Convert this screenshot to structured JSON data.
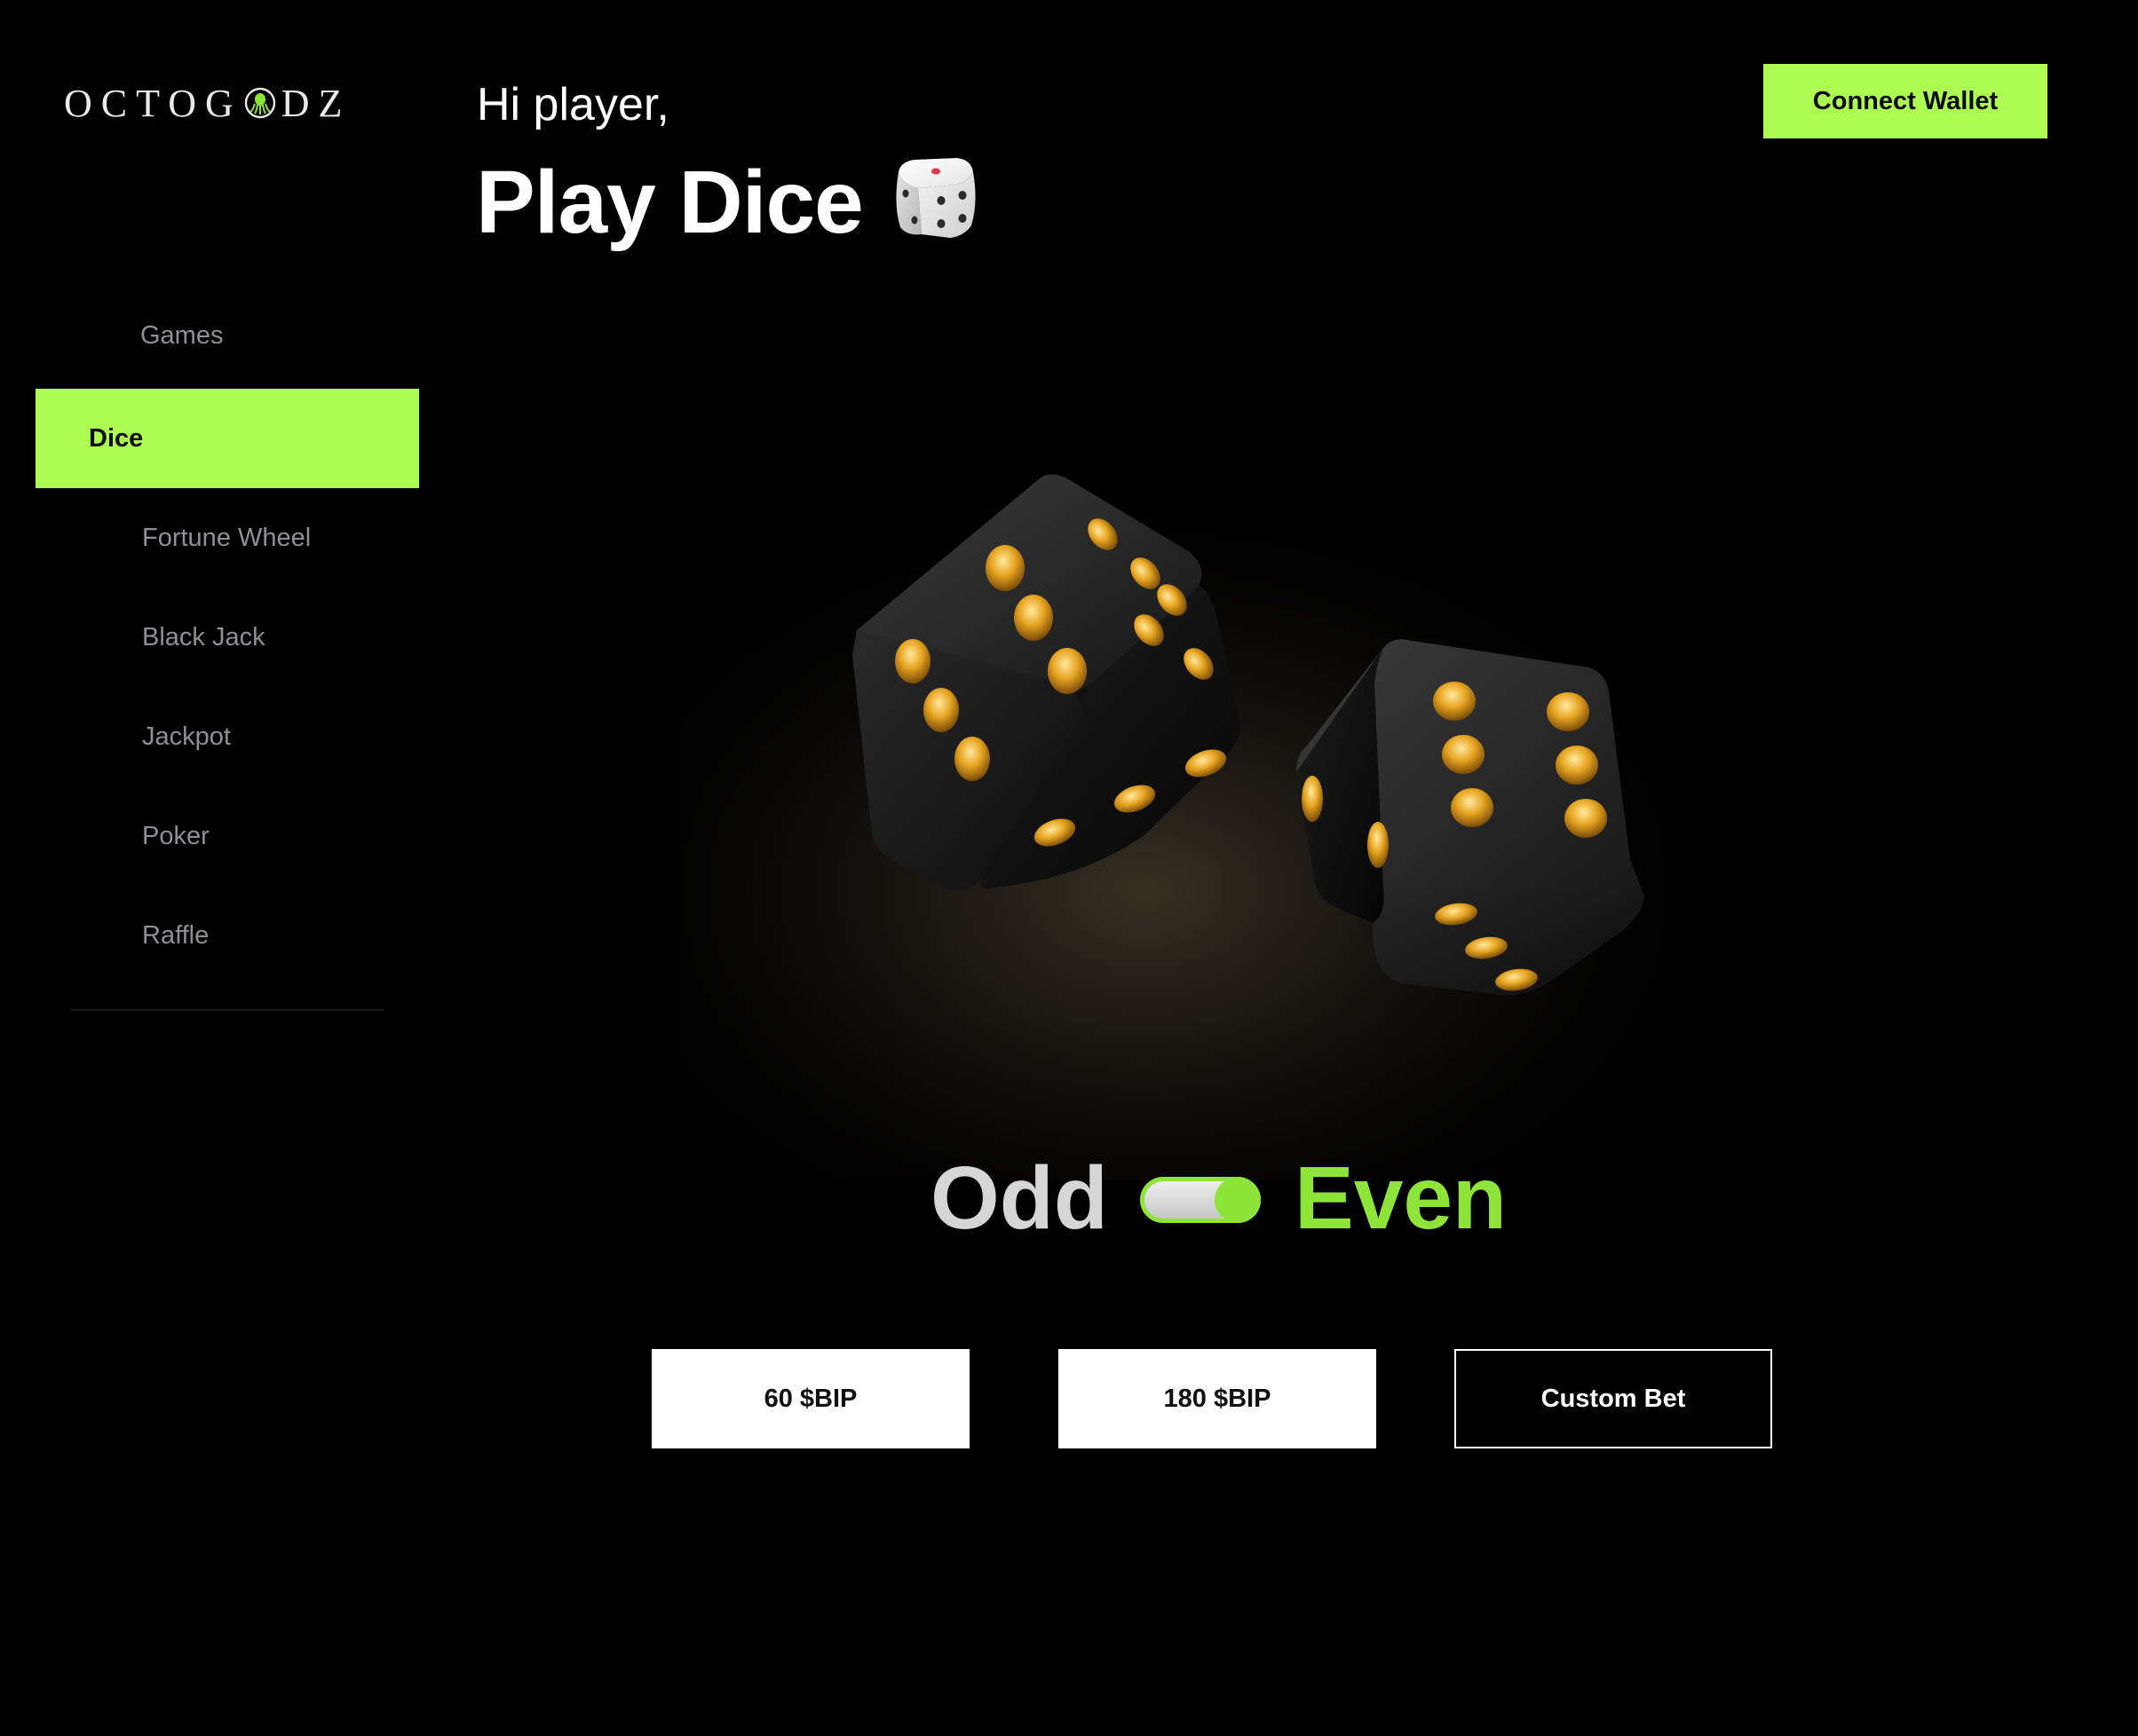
{
  "brand": {
    "logo_text": "OCTOGODZ",
    "accent_color": "#adfa52"
  },
  "header": {
    "greeting": "Hi player,",
    "title": "Play Dice",
    "connect_wallet_label": "Connect Wallet"
  },
  "sidebar": {
    "heading": "Games",
    "items": [
      {
        "label": "Dice",
        "active": true
      },
      {
        "label": "Fortune Wheel",
        "active": false
      },
      {
        "label": "Black Jack",
        "active": false
      },
      {
        "label": "Jackpot",
        "active": false
      },
      {
        "label": "Poker",
        "active": false
      },
      {
        "label": "Raffle",
        "active": false
      }
    ]
  },
  "toggle": {
    "left_label": "Odd",
    "right_label": "Even",
    "selected": "Even"
  },
  "bets": [
    {
      "label": "60 $BIP"
    },
    {
      "label": "180 $BIP"
    },
    {
      "label": "Custom Bet"
    }
  ],
  "icons": {
    "title_icon": "die-icon",
    "hero": "dice-illustration"
  }
}
